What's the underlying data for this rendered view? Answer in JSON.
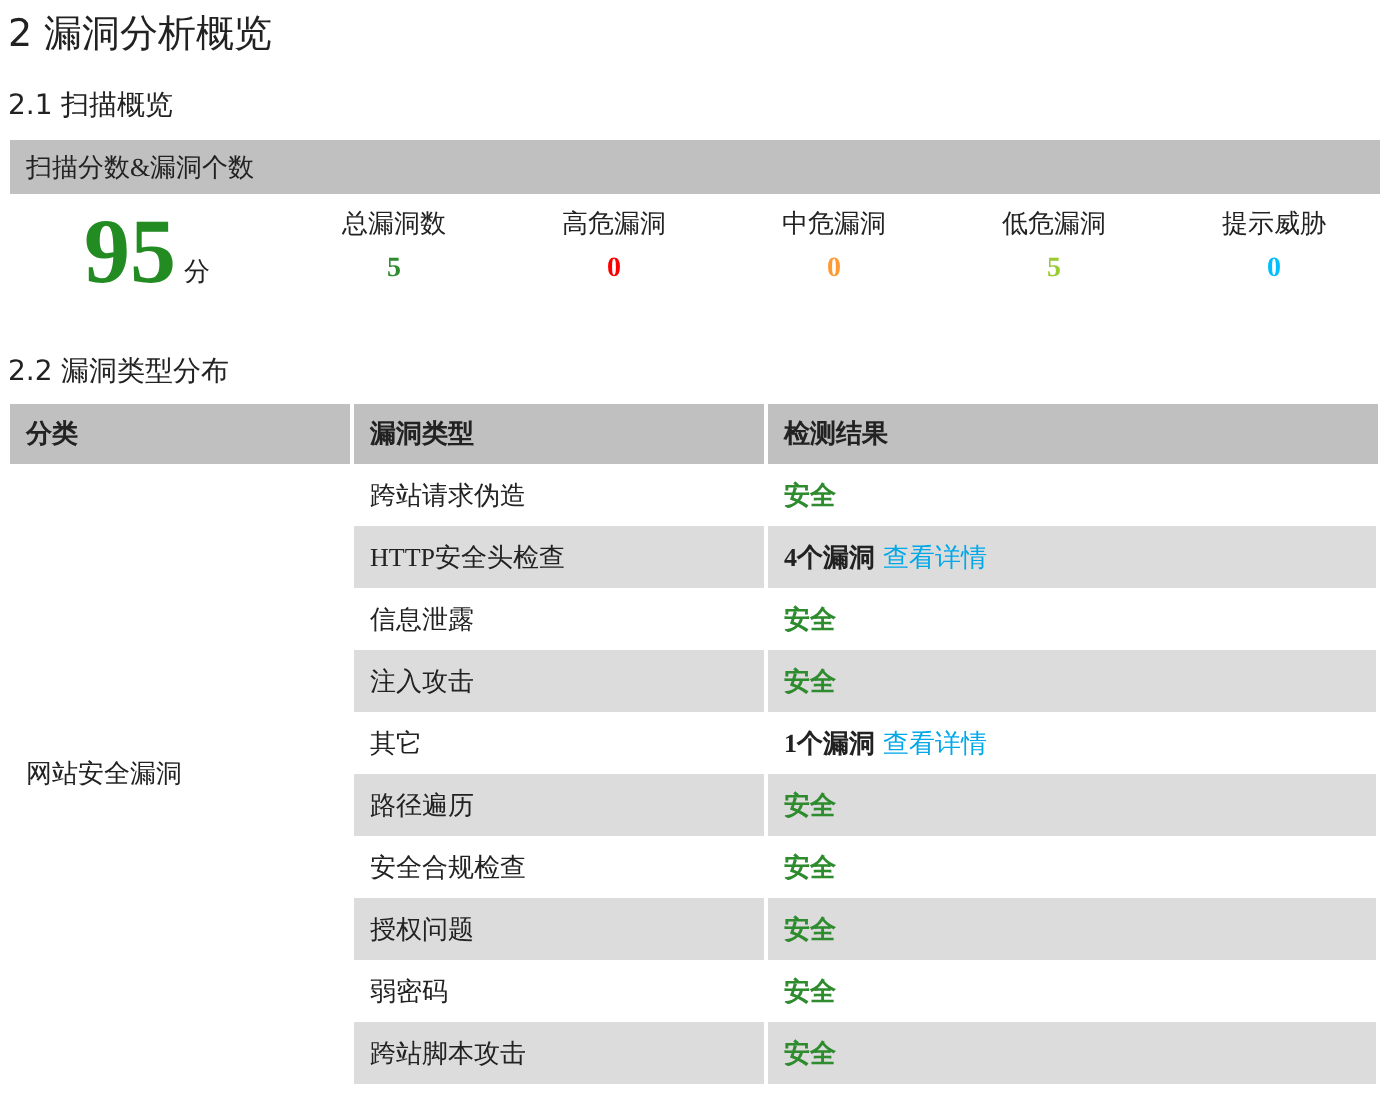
{
  "title": "2 漏洞分析概览",
  "overview": {
    "heading": "2.1 扫描概览",
    "bar_label": "扫描分数&漏洞个数",
    "score": "95",
    "score_unit": "分",
    "stats": [
      {
        "label": "总漏洞数",
        "value": "5",
        "color": "#2e8b2e"
      },
      {
        "label": "高危漏洞",
        "value": "0",
        "color": "#ff0000"
      },
      {
        "label": "中危漏洞",
        "value": "0",
        "color": "#ff9933"
      },
      {
        "label": "低危漏洞",
        "value": "5",
        "color": "#99cc33"
      },
      {
        "label": "提示威胁",
        "value": "0",
        "color": "#00bfff"
      }
    ]
  },
  "distribution": {
    "heading": "2.2 漏洞类型分布",
    "columns": [
      "分类",
      "漏洞类型",
      "检测结果"
    ],
    "category": "网站安全漏洞",
    "rows": [
      {
        "type": "跨站请求伪造",
        "result": {
          "kind": "safe",
          "text": "安全"
        }
      },
      {
        "type": "HTTP安全头检查",
        "result": {
          "kind": "vuln",
          "text": "4个漏洞",
          "link": "查看详情"
        }
      },
      {
        "type": "信息泄露",
        "result": {
          "kind": "safe",
          "text": "安全"
        }
      },
      {
        "type": "注入攻击",
        "result": {
          "kind": "safe",
          "text": "安全"
        }
      },
      {
        "type": "其它",
        "result": {
          "kind": "vuln",
          "text": "1个漏洞",
          "link": "查看详情"
        }
      },
      {
        "type": "路径遍历",
        "result": {
          "kind": "safe",
          "text": "安全"
        }
      },
      {
        "type": "安全合规检查",
        "result": {
          "kind": "safe",
          "text": "安全"
        }
      },
      {
        "type": "授权问题",
        "result": {
          "kind": "safe",
          "text": "安全"
        }
      },
      {
        "type": "弱密码",
        "result": {
          "kind": "safe",
          "text": "安全"
        }
      },
      {
        "type": "跨站脚本攻击",
        "result": {
          "kind": "safe",
          "text": "安全"
        }
      }
    ]
  }
}
